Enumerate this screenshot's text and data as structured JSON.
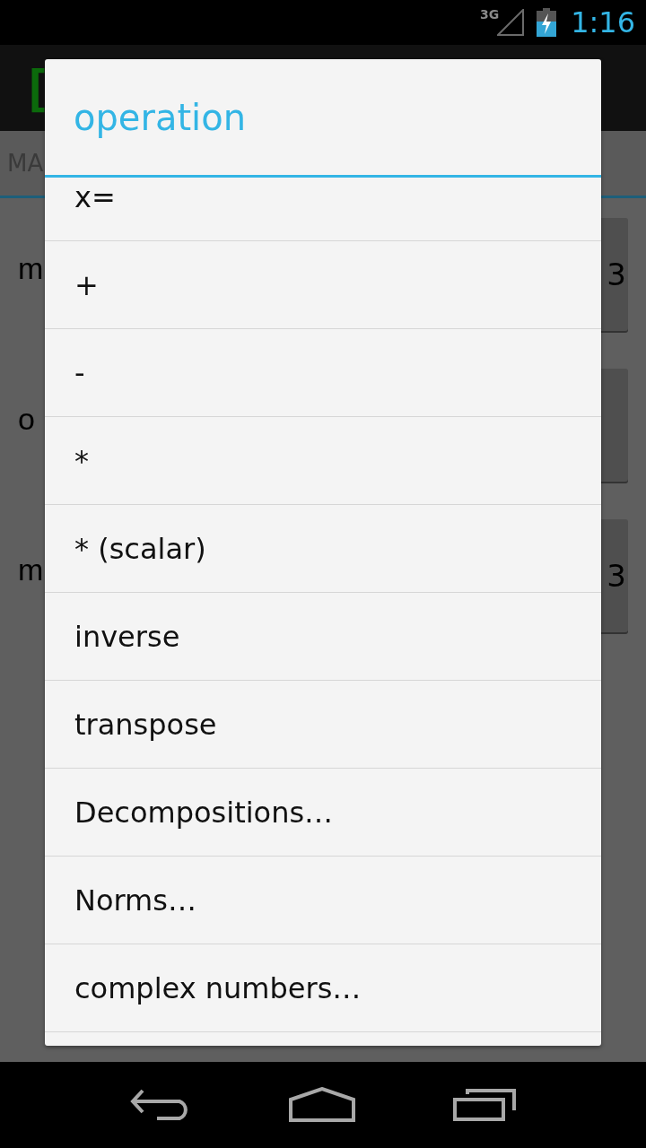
{
  "status_bar": {
    "network": "3G",
    "time": "1:16"
  },
  "app": {
    "logo": "[",
    "tab": "MA",
    "rows": [
      {
        "label": "m",
        "button": "3"
      },
      {
        "label": "o"
      },
      {
        "label": "m",
        "button": "3"
      }
    ]
  },
  "dialog": {
    "title": "operation",
    "items": [
      "x=",
      "+",
      "-",
      "*",
      "* (scalar)",
      "inverse",
      "transpose",
      "Decompositions…",
      "Norms…",
      "complex numbers…"
    ]
  }
}
